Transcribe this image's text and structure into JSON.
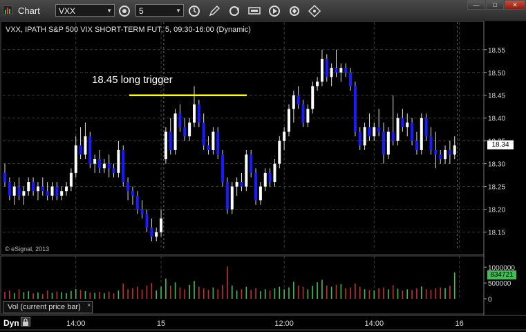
{
  "window": {
    "title": "Chart",
    "symbol": "VXX",
    "interval": "5"
  },
  "toolbar": {
    "icons": [
      "symbol-link-icon",
      "refresh-time-icon",
      "draw-pencil-icon",
      "cycle-icon",
      "quote-icon",
      "play-icon",
      "settings-icon",
      "drag-icon"
    ]
  },
  "chart_header": "VXX, IPATH S&P 500 VIX SHORT-TERM FUT, 5, 09:30-16:00 (Dynamic)",
  "copyright": "© eSignal, 2013",
  "annotation": "18.45 long trigger",
  "annotation_level": 18.45,
  "current_price_label": "18.34",
  "volume_panel": {
    "label": "Vol (current price bar)",
    "close_glyph": "×",
    "current_volume_label": "834721",
    "axis_ticks": [
      "1000000",
      "500000",
      "0"
    ]
  },
  "bottom_bar": {
    "mode": "Dyn"
  },
  "colors": {
    "up": "#ffffff",
    "down": "#1a1aff",
    "wick": "#e0e0e0",
    "trigger_line": "#ffff00",
    "vol_up": "#3fbf4f",
    "vol_down": "#c83030",
    "grid": "#3a3a3a",
    "price_tag_bg": "#ffffff",
    "vol_tag_bg": "#3fbf4f"
  },
  "chart_data": {
    "type": "candlestick",
    "ylim": [
      18.11,
      18.58
    ],
    "y_ticks": [
      18.55,
      18.5,
      18.45,
      18.4,
      18.35,
      18.3,
      18.25,
      18.2,
      18.15
    ],
    "x_tick_labels": [
      "14:00",
      "15",
      "12:00",
      "14:00",
      "16"
    ],
    "x_tick_bar_index": [
      15,
      33,
      59,
      78,
      96
    ],
    "session_break_bar_index": [
      34,
      96
    ],
    "bars": [
      [
        18.28,
        18.3,
        18.25,
        18.26
      ],
      [
        18.26,
        18.27,
        18.22,
        18.23
      ],
      [
        18.23,
        18.26,
        18.21,
        18.25
      ],
      [
        18.25,
        18.27,
        18.22,
        18.23
      ],
      [
        18.23,
        18.25,
        18.21,
        18.24
      ],
      [
        18.24,
        18.27,
        18.23,
        18.26
      ],
      [
        18.26,
        18.27,
        18.23,
        18.24
      ],
      [
        18.24,
        18.26,
        18.22,
        18.25
      ],
      [
        18.25,
        18.27,
        18.23,
        18.24
      ],
      [
        18.24,
        18.26,
        18.22,
        18.23
      ],
      [
        18.23,
        18.26,
        18.22,
        18.25
      ],
      [
        18.25,
        18.26,
        18.22,
        18.23
      ],
      [
        18.23,
        18.25,
        18.22,
        18.24
      ],
      [
        18.24,
        18.26,
        18.23,
        18.25
      ],
      [
        18.25,
        18.29,
        18.24,
        18.28
      ],
      [
        18.28,
        18.36,
        18.27,
        18.34
      ],
      [
        18.34,
        18.38,
        18.31,
        18.32
      ],
      [
        18.32,
        18.39,
        18.31,
        18.36
      ],
      [
        18.36,
        18.37,
        18.29,
        18.3
      ],
      [
        18.3,
        18.32,
        18.28,
        18.31
      ],
      [
        18.31,
        18.33,
        18.28,
        18.29
      ],
      [
        18.29,
        18.31,
        18.28,
        18.3
      ],
      [
        18.3,
        18.32,
        18.27,
        18.29
      ],
      [
        18.29,
        18.3,
        18.27,
        18.28
      ],
      [
        18.28,
        18.35,
        18.27,
        18.33
      ],
      [
        18.33,
        18.34,
        18.25,
        18.26
      ],
      [
        18.26,
        18.27,
        18.22,
        18.24
      ],
      [
        18.24,
        18.25,
        18.21,
        18.23
      ],
      [
        18.23,
        18.24,
        18.19,
        18.2
      ],
      [
        18.2,
        18.22,
        18.18,
        18.19
      ],
      [
        18.19,
        18.2,
        18.15,
        18.16
      ],
      [
        18.16,
        18.18,
        18.13,
        18.14
      ],
      [
        18.14,
        18.16,
        18.13,
        18.15
      ],
      [
        18.15,
        18.2,
        18.14,
        18.18
      ],
      [
        18.31,
        18.38,
        18.3,
        18.37
      ],
      [
        18.37,
        18.4,
        18.32,
        18.33
      ],
      [
        18.33,
        18.42,
        18.32,
        18.41
      ],
      [
        18.41,
        18.43,
        18.37,
        18.38
      ],
      [
        18.38,
        18.4,
        18.35,
        18.36
      ],
      [
        18.36,
        18.4,
        18.35,
        18.39
      ],
      [
        18.39,
        18.47,
        18.38,
        18.43
      ],
      [
        18.43,
        18.44,
        18.38,
        18.39
      ],
      [
        18.39,
        18.41,
        18.33,
        18.34
      ],
      [
        18.34,
        18.36,
        18.32,
        18.33
      ],
      [
        18.33,
        18.38,
        18.32,
        18.37
      ],
      [
        18.37,
        18.38,
        18.31,
        18.32
      ],
      [
        18.32,
        18.33,
        18.25,
        18.26
      ],
      [
        18.26,
        18.27,
        18.19,
        18.2
      ],
      [
        18.2,
        18.26,
        18.19,
        18.25
      ],
      [
        18.25,
        18.27,
        18.23,
        18.26
      ],
      [
        18.26,
        18.28,
        18.24,
        18.25
      ],
      [
        18.25,
        18.33,
        18.24,
        18.32
      ],
      [
        18.32,
        18.33,
        18.27,
        18.28
      ],
      [
        18.28,
        18.29,
        18.21,
        18.22
      ],
      [
        18.22,
        18.26,
        18.21,
        18.25
      ],
      [
        18.25,
        18.29,
        18.24,
        18.28
      ],
      [
        18.28,
        18.29,
        18.25,
        18.26
      ],
      [
        18.26,
        18.31,
        18.25,
        18.3
      ],
      [
        18.3,
        18.36,
        18.29,
        18.35
      ],
      [
        18.35,
        18.38,
        18.33,
        18.37
      ],
      [
        18.37,
        18.43,
        18.36,
        18.42
      ],
      [
        18.42,
        18.46,
        18.39,
        18.45
      ],
      [
        18.45,
        18.47,
        18.42,
        18.43
      ],
      [
        18.43,
        18.44,
        18.38,
        18.39
      ],
      [
        18.39,
        18.43,
        18.38,
        18.42
      ],
      [
        18.42,
        18.48,
        18.41,
        18.47
      ],
      [
        18.47,
        18.49,
        18.46,
        18.48
      ],
      [
        18.48,
        18.55,
        18.47,
        18.53
      ],
      [
        18.53,
        18.54,
        18.48,
        18.49
      ],
      [
        18.49,
        18.52,
        18.47,
        18.51
      ],
      [
        18.51,
        18.55,
        18.49,
        18.5
      ],
      [
        18.5,
        18.52,
        18.48,
        18.51
      ],
      [
        18.51,
        18.52,
        18.49,
        18.5
      ],
      [
        18.5,
        18.51,
        18.46,
        18.47
      ],
      [
        18.47,
        18.48,
        18.36,
        18.37
      ],
      [
        18.37,
        18.38,
        18.33,
        18.34
      ],
      [
        18.34,
        18.39,
        18.33,
        18.38
      ],
      [
        18.38,
        18.41,
        18.35,
        18.36
      ],
      [
        18.36,
        18.39,
        18.35,
        18.38
      ],
      [
        18.38,
        18.42,
        18.36,
        18.37
      ],
      [
        18.37,
        18.39,
        18.3,
        18.32
      ],
      [
        18.32,
        18.38,
        18.31,
        18.37
      ],
      [
        18.37,
        18.45,
        18.34,
        18.35
      ],
      [
        18.35,
        18.41,
        18.34,
        18.4
      ],
      [
        18.4,
        18.42,
        18.37,
        18.38
      ],
      [
        18.38,
        18.41,
        18.36,
        18.39
      ],
      [
        18.39,
        18.4,
        18.34,
        18.35
      ],
      [
        18.35,
        18.37,
        18.32,
        18.33
      ],
      [
        18.33,
        18.41,
        18.32,
        18.4
      ],
      [
        18.4,
        18.41,
        18.35,
        18.36
      ],
      [
        18.36,
        18.38,
        18.32,
        18.33
      ],
      [
        18.33,
        18.37,
        18.29,
        18.32
      ],
      [
        18.32,
        18.33,
        18.3,
        18.31
      ],
      [
        18.31,
        18.34,
        18.3,
        18.33
      ],
      [
        18.33,
        18.35,
        18.3,
        18.32
      ],
      [
        18.32,
        18.36,
        18.31,
        18.34
      ]
    ],
    "volume": [
      220000,
      260000,
      180000,
      300000,
      210000,
      240000,
      170000,
      200000,
      150000,
      260000,
      190000,
      230000,
      210000,
      180000,
      250000,
      310000,
      280000,
      240000,
      200000,
      190000,
      220000,
      180000,
      230000,
      170000,
      260000,
      480000,
      300000,
      340000,
      380000,
      290000,
      420000,
      500000,
      260000,
      380000,
      640000,
      420000,
      520000,
      360000,
      300000,
      440000,
      560000,
      380000,
      330000,
      280000,
      360000,
      300000,
      440000,
      1020000,
      420000,
      260000,
      300000,
      380000,
      280000,
      340000,
      240000,
      300000,
      260000,
      330000,
      380000,
      300000,
      360000,
      540000,
      420000,
      380000,
      300000,
      410000,
      520000,
      600000,
      420000,
      380000,
      440000,
      460000,
      330000,
      360000,
      480000,
      380000,
      300000,
      280000,
      260000,
      330000,
      360000,
      300000,
      430000,
      320000,
      260000,
      300000,
      280000,
      330000,
      390000,
      300000,
      280000,
      330000,
      360000,
      340000,
      410000,
      834721
    ],
    "volume_ylim": [
      0,
      1050000
    ]
  }
}
